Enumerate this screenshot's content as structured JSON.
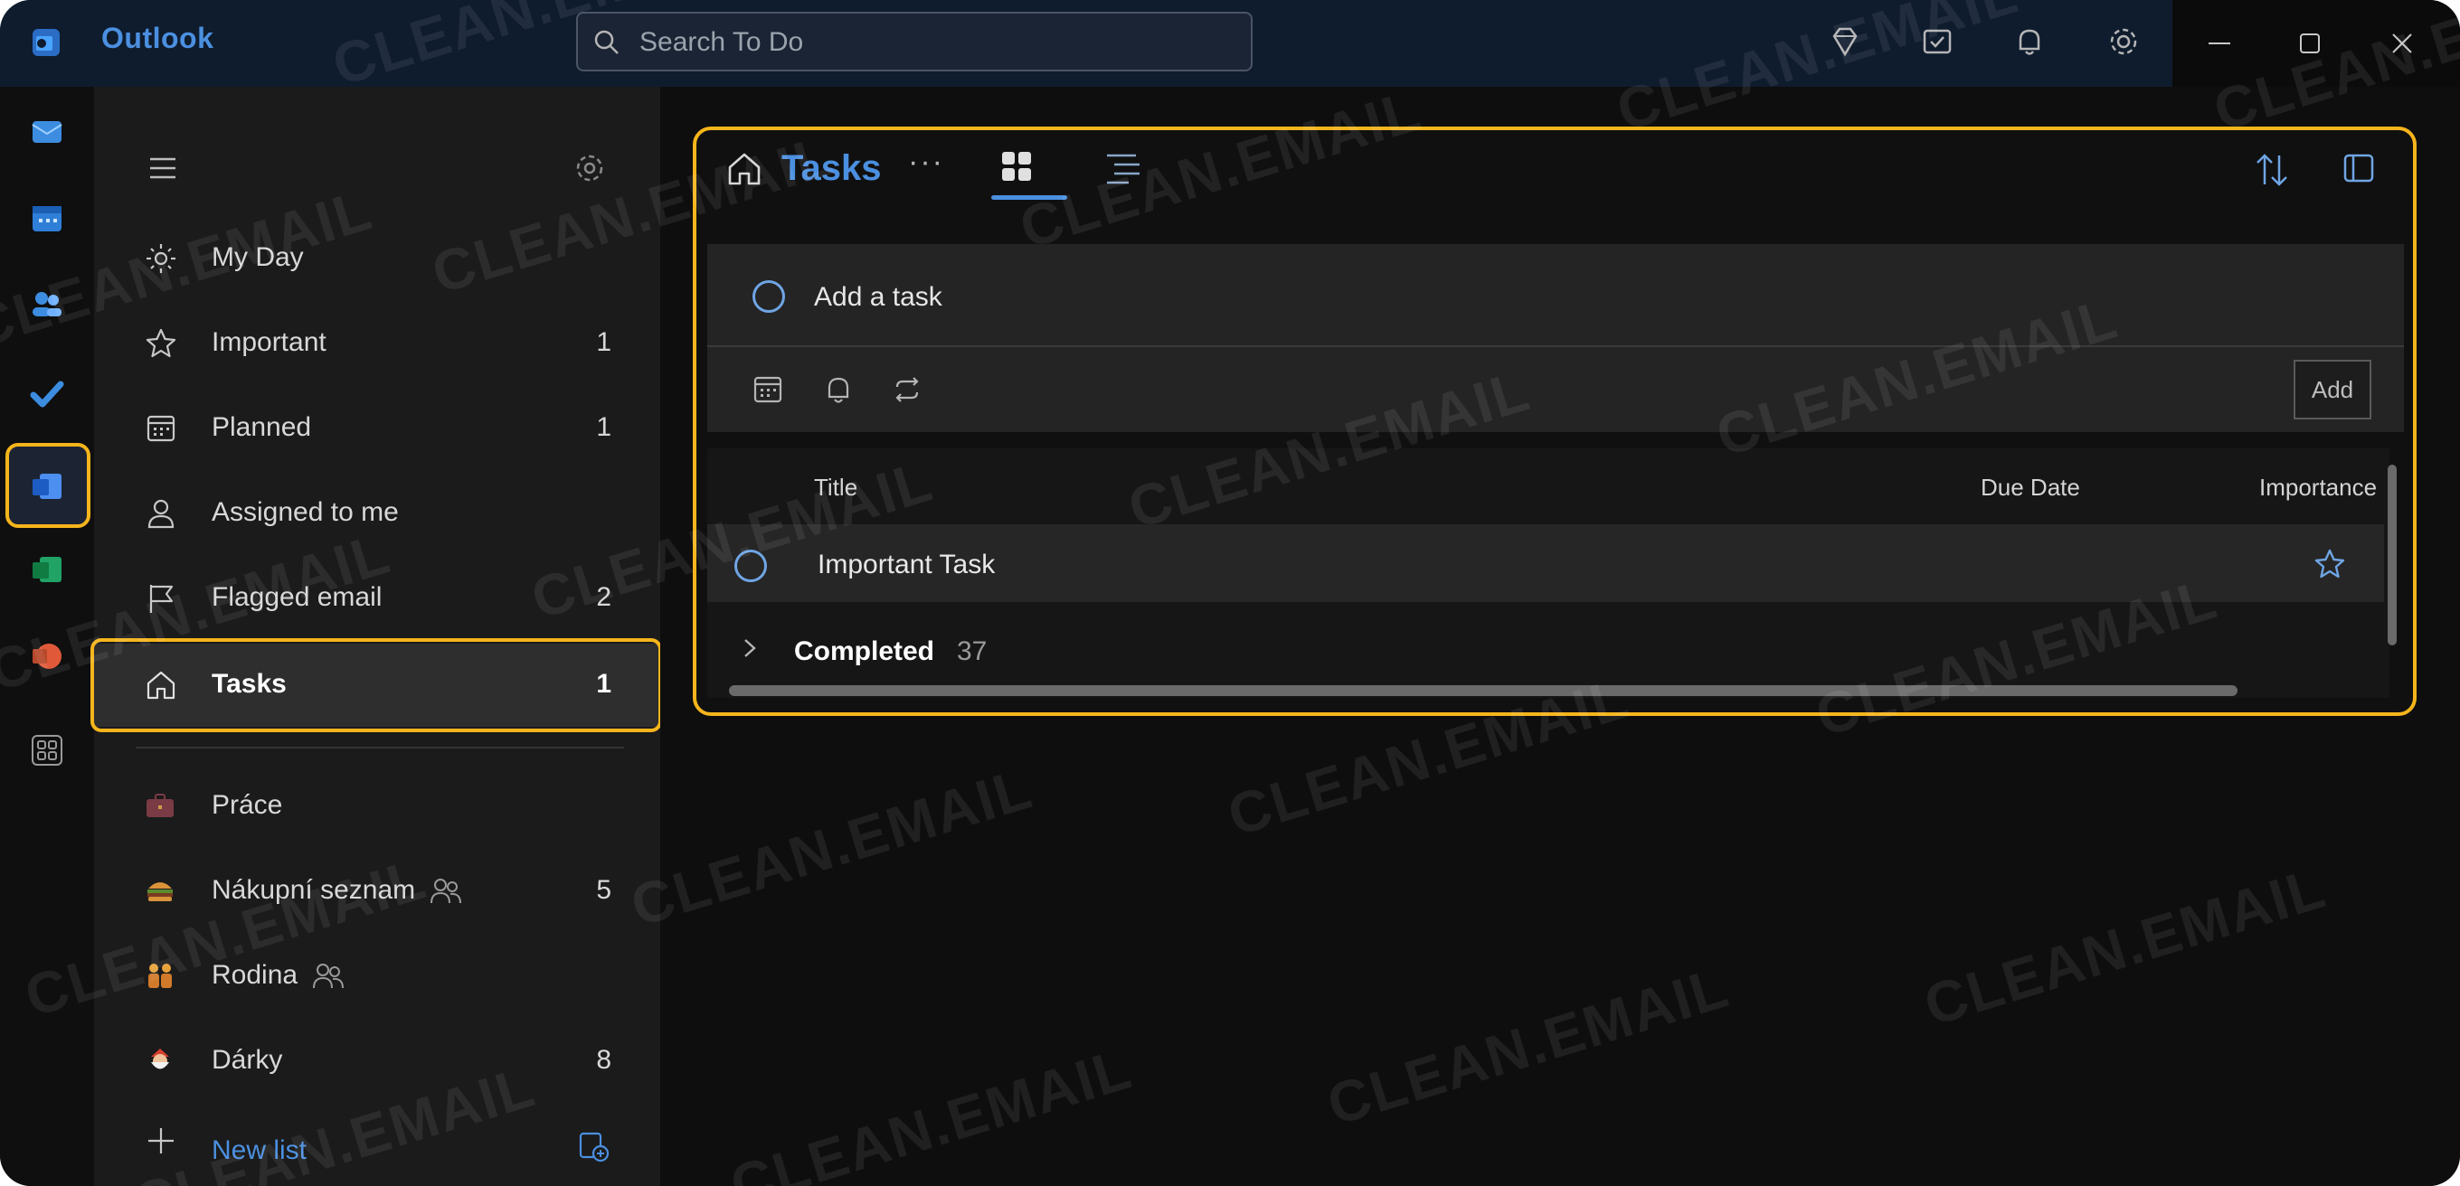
{
  "app": {
    "name": "Outlook"
  },
  "search": {
    "placeholder": "Search To Do"
  },
  "sidebar": {
    "smart_lists": [
      {
        "label": "My Day",
        "count": ""
      },
      {
        "label": "Important",
        "count": "1"
      },
      {
        "label": "Planned",
        "count": "1"
      },
      {
        "label": "Assigned to me",
        "count": ""
      },
      {
        "label": "Flagged email",
        "count": "2"
      },
      {
        "label": "Tasks",
        "count": "1"
      }
    ],
    "custom_lists": [
      {
        "label": "Práce",
        "count": "",
        "icon": "briefcase-emoji"
      },
      {
        "label": "Nákupní seznam",
        "count": "5",
        "icon": "burger-emoji",
        "shared": true
      },
      {
        "label": "Rodina",
        "count": "",
        "icon": "family-emoji",
        "shared": true
      },
      {
        "label": "Dárky",
        "count": "8",
        "icon": "santa-emoji"
      }
    ],
    "new_list": "New list"
  },
  "main": {
    "title": "Tasks",
    "more": "···",
    "add_task": {
      "placeholder": "Add a task",
      "button": "Add"
    },
    "columns": {
      "title": "Title",
      "due": "Due Date",
      "importance": "Importance"
    },
    "tasks": [
      {
        "title": "Important Task",
        "important": true
      }
    ],
    "completed": {
      "label": "Completed",
      "count": "37"
    }
  },
  "watermark": "CLEAN.EMAIL",
  "colors": {
    "accent": "#4b8fe0",
    "highlight": "#f6b51c",
    "titlebar": "#0f1c2e"
  }
}
